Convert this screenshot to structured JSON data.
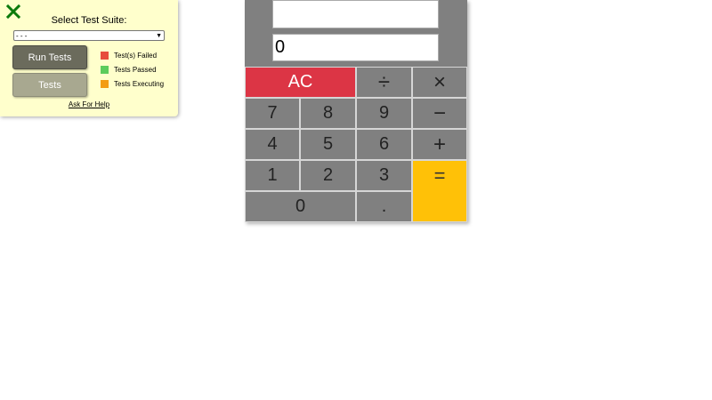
{
  "test_panel": {
    "close_icon": "close-x-icon",
    "close_color": "#0b7a0b",
    "title": "Select Test Suite:",
    "select_value": "- - -",
    "run_button": "Run Tests",
    "tests_button": "Tests",
    "legend": [
      {
        "label": "Test(s) Failed",
        "color": "#e74c3c"
      },
      {
        "label": "Tests Passed",
        "color": "#5ccc5c"
      },
      {
        "label": "Tests Executing",
        "color": "#f39c12"
      }
    ],
    "help_link": "Ask For Help"
  },
  "calculator": {
    "previous_display": "",
    "current_display": "0",
    "keys": {
      "clear": "AC",
      "divide": "÷",
      "multiply": "×",
      "seven": "7",
      "eight": "8",
      "nine": "9",
      "subtract": "−",
      "four": "4",
      "five": "5",
      "six": "6",
      "add": "+",
      "one": "1",
      "two": "2",
      "three": "3",
      "equals": "=",
      "zero": "0",
      "decimal": "."
    },
    "colors": {
      "body": "#808080",
      "clear": "#dc3545",
      "equals": "#ffc107"
    }
  }
}
